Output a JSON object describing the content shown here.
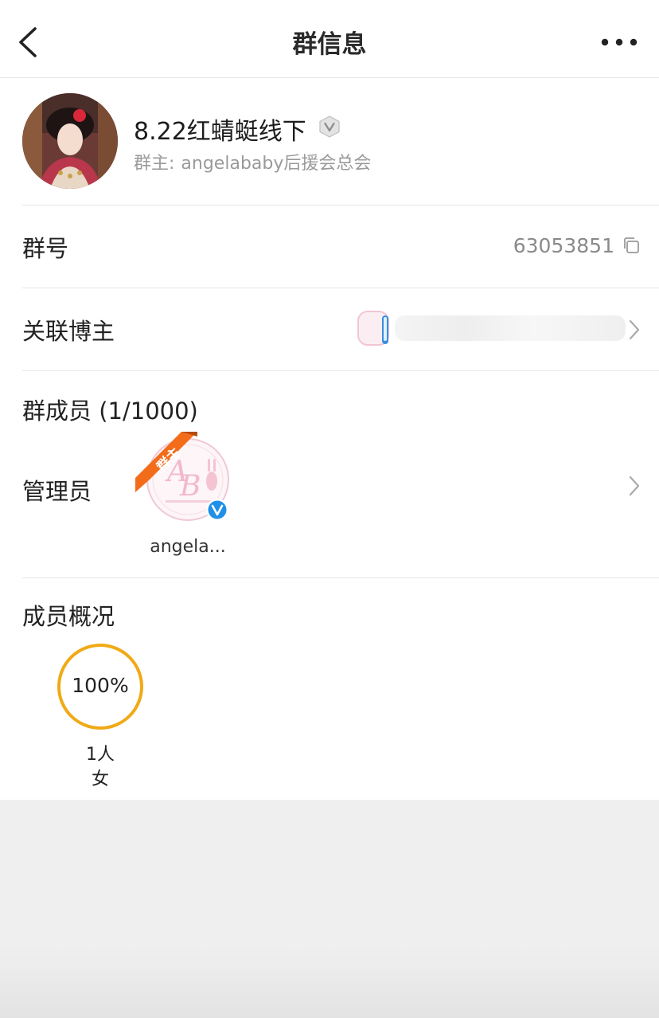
{
  "header": {
    "title": "群信息"
  },
  "group": {
    "name": "8.22红蜻蜓线下",
    "owner_label": "群主:",
    "owner_name": "angelababy后援会总会"
  },
  "rows": {
    "group_id_label": "群号",
    "group_id_value": "63053851",
    "linked_blogger_label": "关联博主",
    "members_label": "群成员 (1/1000)",
    "admins_label": "管理员"
  },
  "admin": {
    "badge": "群主",
    "name": "angela..."
  },
  "overview": {
    "label": "成员概况",
    "percent_text": "100%",
    "percent": 100,
    "count": "1人",
    "gender": "女"
  },
  "colors": {
    "accent_ring": "#f0aa17",
    "owner_badge": "#f26c1a",
    "verified": "#1e90e8"
  },
  "icons": [
    "back-icon",
    "more-icon",
    "verified-icon",
    "copy-icon",
    "chevron-right-icon"
  ]
}
